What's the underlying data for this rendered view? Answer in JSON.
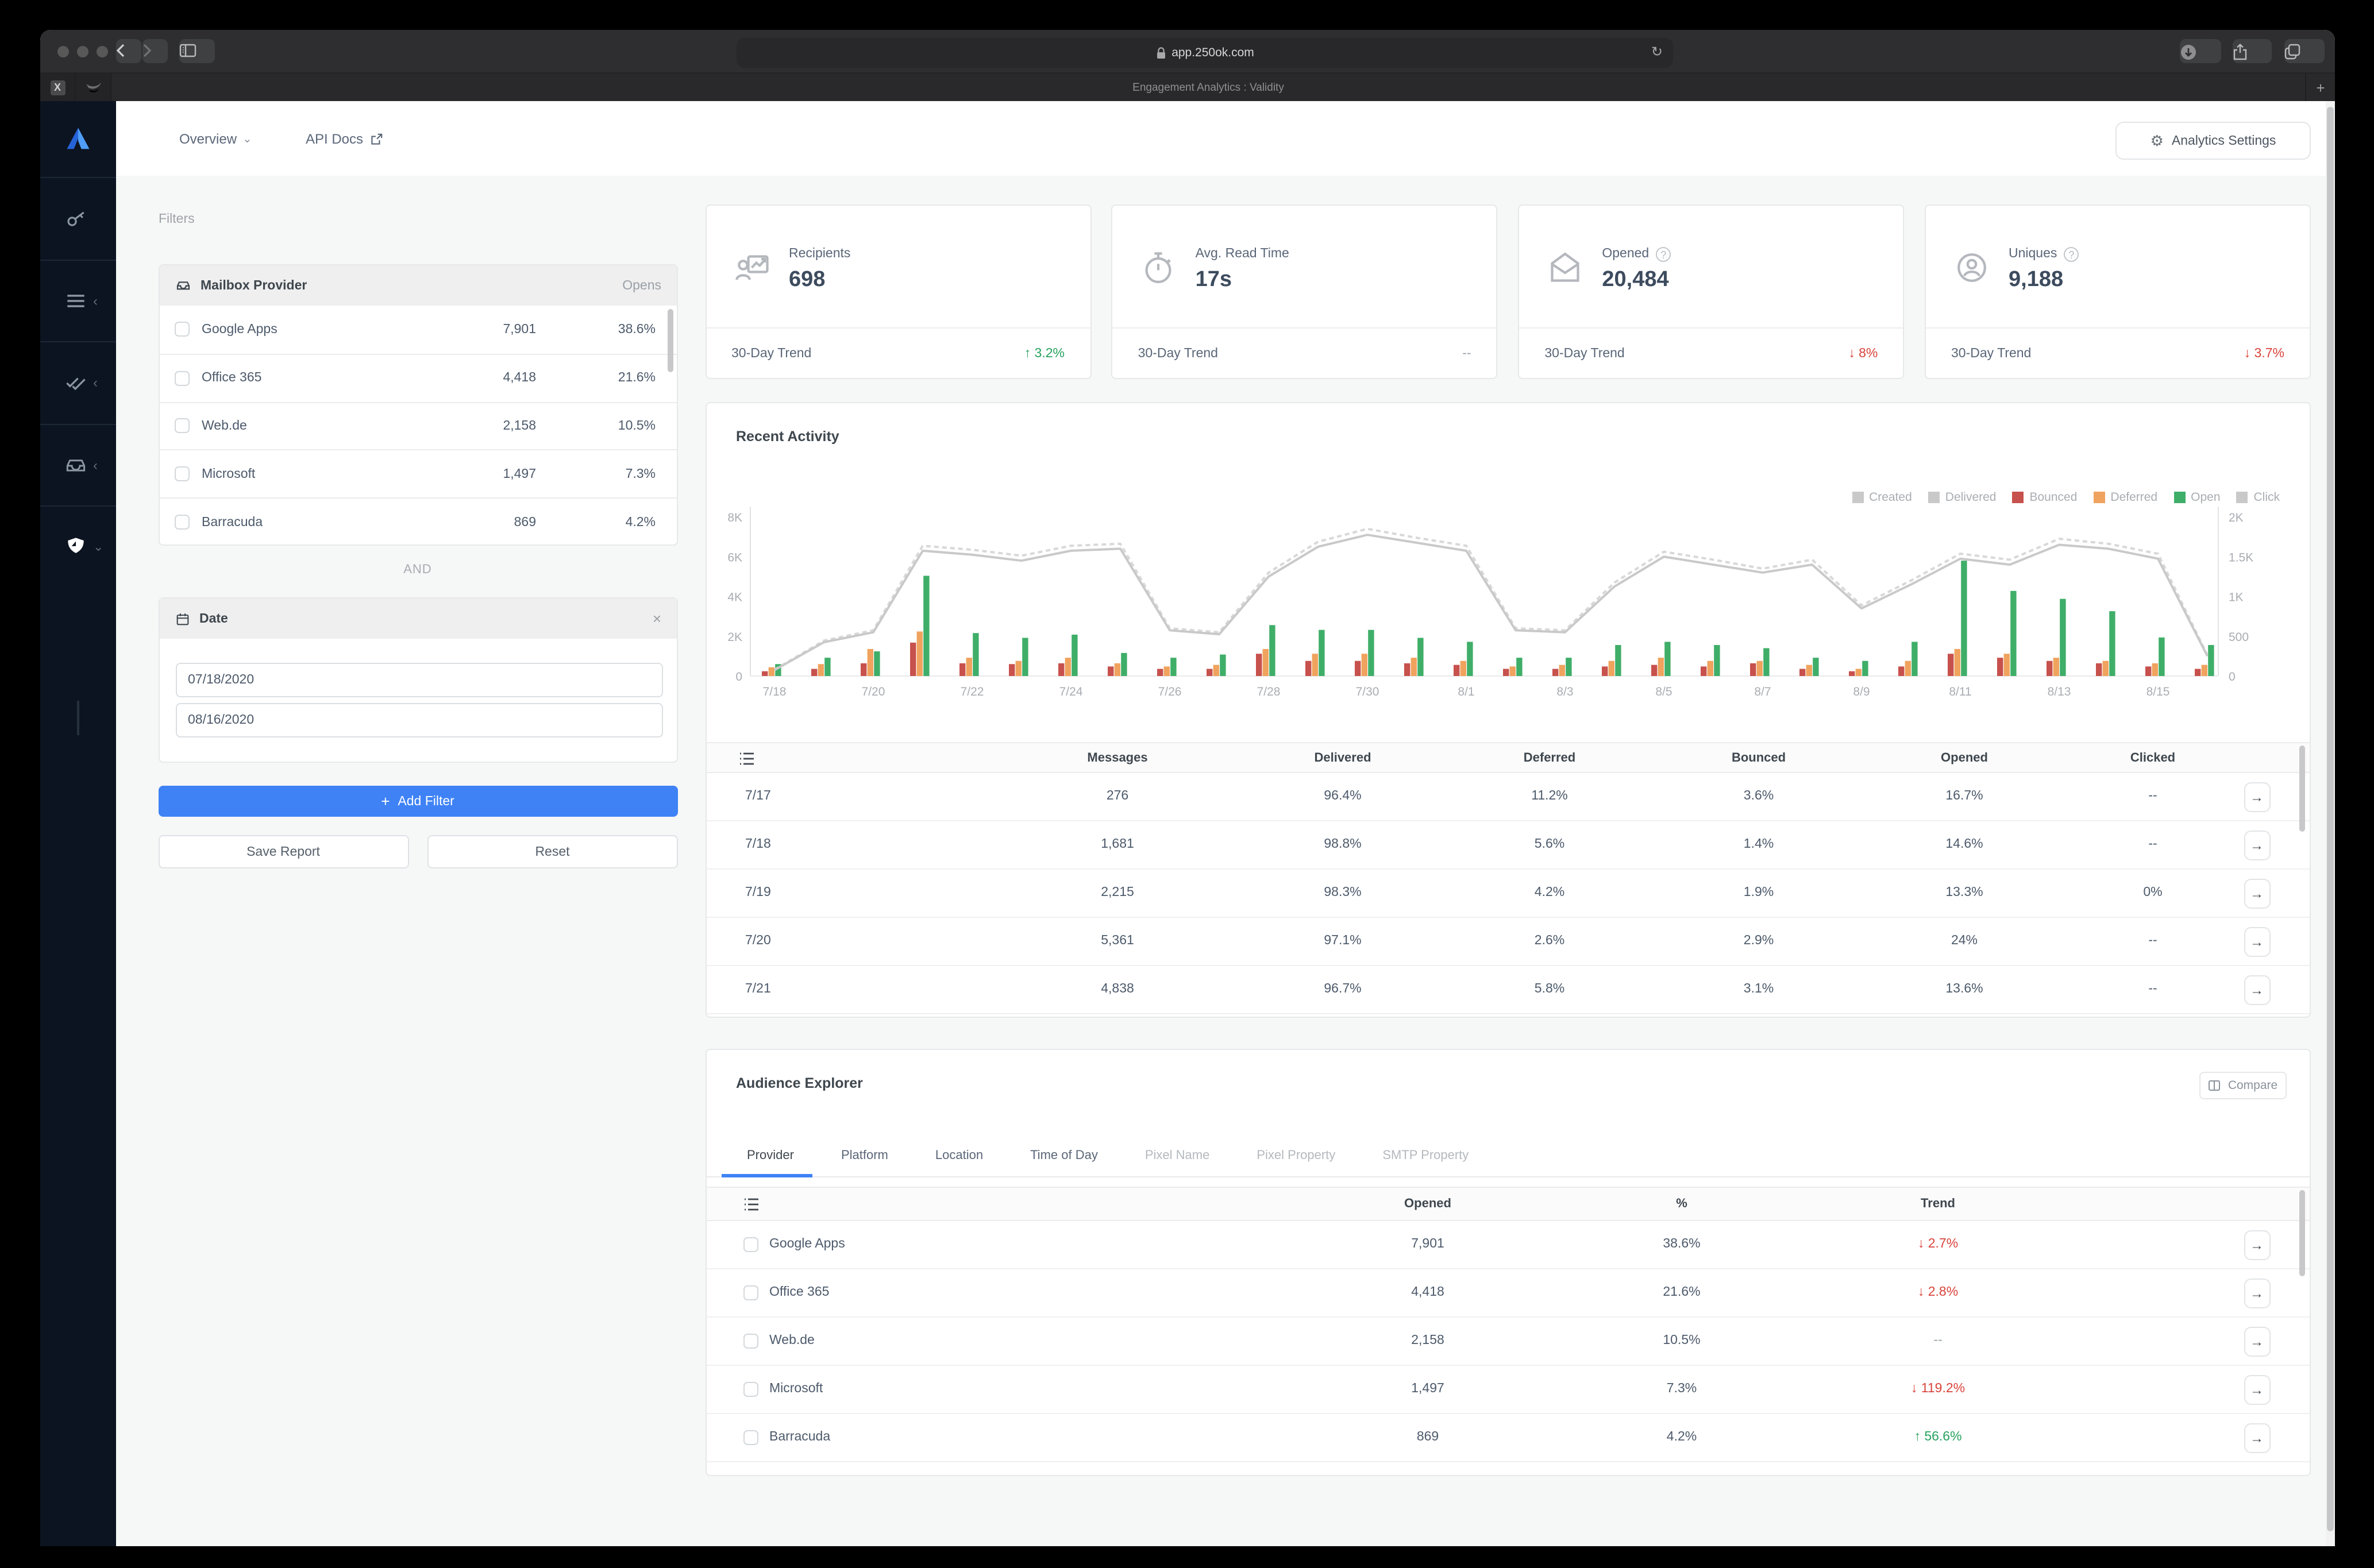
{
  "browser": {
    "url": "app.250ok.com",
    "tab_title": "Engagement Analytics : Validity",
    "pinned_tab_excel": "X",
    "reload_glyph": "↻",
    "new_tab_glyph": "+",
    "back_disabled": false
  },
  "nav": {
    "overview": "Overview",
    "api_docs": "API Docs",
    "settings": "Analytics Settings"
  },
  "filters": {
    "heading": "Filters",
    "provider_card": {
      "title": "Mailbox Provider",
      "metric": "Opens",
      "rows": [
        {
          "name": "Google Apps",
          "opens": "7,901",
          "pct": "38.6%"
        },
        {
          "name": "Office 365",
          "opens": "4,418",
          "pct": "21.6%"
        },
        {
          "name": "Web.de",
          "opens": "2,158",
          "pct": "10.5%"
        },
        {
          "name": "Microsoft",
          "opens": "1,497",
          "pct": "7.3%"
        },
        {
          "name": "Barracuda",
          "opens": "869",
          "pct": "4.2%"
        }
      ]
    },
    "conjunction": "AND",
    "date_card": {
      "title": "Date",
      "close": "×",
      "start": "07/18/2020",
      "end": "08/16/2020"
    },
    "add_filter": "Add Filter",
    "save_report": "Save Report",
    "reset": "Reset"
  },
  "stats": [
    {
      "label": "Recipients",
      "value": "698",
      "trend_label": "30-Day Trend",
      "trend": "↑ 3.2%",
      "trend_color": "#27a35f"
    },
    {
      "label": "Avg. Read Time",
      "value": "17s",
      "trend_label": "30-Day Trend",
      "trend": "--",
      "trend_color": "#9aa0a6"
    },
    {
      "label": "Opened",
      "help": "?",
      "value": "20,484",
      "trend_label": "30-Day Trend",
      "trend": "↓ 8%",
      "trend_color": "#d9443c"
    },
    {
      "label": "Uniques",
      "help": "?",
      "value": "9,188",
      "trend_label": "30-Day Trend",
      "trend": "↓ 3.7%",
      "trend_color": "#d9443c"
    }
  ],
  "recent": {
    "title": "Recent Activity",
    "legend": [
      {
        "label": "Created",
        "color": "#c9c9c9"
      },
      {
        "label": "Delivered",
        "color": "#c9c9c9"
      },
      {
        "label": "Bounced",
        "color": "#c7514d"
      },
      {
        "label": "Deferred",
        "color": "#f0a35e"
      },
      {
        "label": "Open",
        "color": "#3fae68"
      },
      {
        "label": "Click",
        "color": "#c9c9c9"
      }
    ],
    "headers": [
      "Messages",
      "Delivered",
      "Deferred",
      "Bounced",
      "Opened",
      "Clicked"
    ],
    "rows": [
      {
        "date": "7/17",
        "messages": "276",
        "delivered": "96.4%",
        "deferred": "11.2%",
        "bounced": "3.6%",
        "opened": "16.7%",
        "clicked": "--"
      },
      {
        "date": "7/18",
        "messages": "1,681",
        "delivered": "98.8%",
        "deferred": "5.6%",
        "bounced": "1.4%",
        "opened": "14.6%",
        "clicked": "--"
      },
      {
        "date": "7/19",
        "messages": "2,215",
        "delivered": "98.3%",
        "deferred": "4.2%",
        "bounced": "1.9%",
        "opened": "13.3%",
        "clicked": "0%"
      },
      {
        "date": "7/20",
        "messages": "5,361",
        "delivered": "97.1%",
        "deferred": "2.6%",
        "bounced": "2.9%",
        "opened": "24%",
        "clicked": "--"
      },
      {
        "date": "7/21",
        "messages": "4,838",
        "delivered": "96.7%",
        "deferred": "5.8%",
        "bounced": "3.1%",
        "opened": "13.6%",
        "clicked": "--"
      }
    ],
    "row_arrow": "→"
  },
  "chart_data": {
    "type": "bar",
    "title": "Recent Activity",
    "x": [
      "7/18",
      "7/19",
      "7/20",
      "7/21",
      "7/22",
      "7/23",
      "7/24",
      "7/25",
      "7/26",
      "7/27",
      "7/28",
      "7/29",
      "7/30",
      "7/31",
      "8/1",
      "8/2",
      "8/3",
      "8/4",
      "8/5",
      "8/6",
      "8/7",
      "8/8",
      "8/9",
      "8/10",
      "8/11",
      "8/12",
      "8/13",
      "8/14",
      "8/15",
      "8/16"
    ],
    "x_tick_labels": [
      "7/18",
      "7/20",
      "7/22",
      "7/24",
      "7/26",
      "7/28",
      "7/30",
      "8/1",
      "8/3",
      "8/5",
      "8/7",
      "8/9",
      "8/11",
      "8/13",
      "8/15"
    ],
    "left_axis": {
      "max": 8000,
      "tick_values": [
        8000,
        6000,
        4000,
        2000,
        0
      ],
      "tick_labels": [
        "8K",
        "6K",
        "4K",
        "2K",
        "0"
      ]
    },
    "right_axis": {
      "max": 2000,
      "tick_values": [
        2000,
        1500,
        1000,
        500,
        0
      ],
      "tick_labels": [
        "2K",
        "1.5K",
        "1K",
        "500",
        "0"
      ]
    },
    "legend_position": "top-right",
    "grid": false,
    "series": [
      {
        "name": "Created",
        "type": "line",
        "style": "dashed",
        "axis": "left",
        "color": "#d8d8d8",
        "values": [
          320,
          1780,
          2300,
          6550,
          6350,
          6050,
          6550,
          6650,
          2400,
          2200,
          5200,
          6750,
          7400,
          6950,
          6550,
          2400,
          2300,
          4700,
          6250,
          5850,
          5400,
          5850,
          3550,
          4800,
          6150,
          5850,
          6900,
          6650,
          6150,
          1050
        ]
      },
      {
        "name": "Delivered",
        "type": "line",
        "style": "solid",
        "axis": "left",
        "color": "#c9c9c9",
        "values": [
          300,
          1700,
          2200,
          6300,
          6100,
          5800,
          6300,
          6400,
          2300,
          2100,
          5000,
          6500,
          7100,
          6700,
          6300,
          2300,
          2200,
          4500,
          6000,
          5600,
          5200,
          5600,
          3400,
          4600,
          5900,
          5600,
          6600,
          6400,
          5900,
          1000
        ]
      },
      {
        "name": "Bounced",
        "type": "bar",
        "axis": "right",
        "color": "#c7514d",
        "values": [
          60,
          90,
          160,
          420,
          160,
          150,
          160,
          120,
          90,
          90,
          280,
          190,
          190,
          160,
          140,
          90,
          90,
          120,
          140,
          120,
          160,
          90,
          60,
          120,
          280,
          230,
          190,
          160,
          120,
          90
        ]
      },
      {
        "name": "Deferred",
        "type": "bar",
        "axis": "right",
        "color": "#f0a35e",
        "values": [
          110,
          150,
          340,
          560,
          230,
          190,
          230,
          160,
          120,
          140,
          340,
          280,
          280,
          230,
          190,
          120,
          140,
          190,
          230,
          190,
          190,
          140,
          90,
          190,
          340,
          280,
          230,
          190,
          160,
          140
        ]
      },
      {
        "name": "Open",
        "type": "bar",
        "axis": "right",
        "color": "#3fae68",
        "values": [
          150,
          230,
          310,
          1260,
          540,
          480,
          520,
          290,
          230,
          270,
          640,
          580,
          580,
          480,
          430,
          230,
          230,
          390,
          430,
          390,
          350,
          230,
          190,
          430,
          1450,
          1070,
          970,
          815,
          485,
          390
        ]
      },
      {
        "name": "Click",
        "type": "bar",
        "axis": "right",
        "color": "#c9c9c9",
        "values": [
          0,
          0,
          0,
          0,
          0,
          0,
          0,
          0,
          0,
          0,
          0,
          0,
          0,
          0,
          0,
          0,
          0,
          0,
          0,
          0,
          0,
          0,
          0,
          0,
          0,
          0,
          0,
          0,
          0,
          0
        ]
      }
    ]
  },
  "audience": {
    "title": "Audience Explorer",
    "compare": "Compare",
    "tabs": [
      "Provider",
      "Platform",
      "Location",
      "Time of Day",
      "Pixel Name",
      "Pixel Property",
      "SMTP Property"
    ],
    "headers": [
      "Opened",
      "%",
      "Trend"
    ],
    "rows": [
      {
        "name": "Google Apps",
        "opened": "7,901",
        "pct": "38.6%",
        "trend": "↓ 2.7%",
        "trend_color": "#d9443c"
      },
      {
        "name": "Office 365",
        "opened": "4,418",
        "pct": "21.6%",
        "trend": "↓ 2.8%",
        "trend_color": "#d9443c"
      },
      {
        "name": "Web.de",
        "opened": "2,158",
        "pct": "10.5%",
        "trend": "--",
        "trend_color": "#9aa0a6"
      },
      {
        "name": "Microsoft",
        "opened": "1,497",
        "pct": "7.3%",
        "trend": "↓ 119.2%",
        "trend_color": "#d9443c"
      },
      {
        "name": "Barracuda",
        "opened": "869",
        "pct": "4.2%",
        "trend": "↑ 56.6%",
        "trend_color": "#27a35f"
      }
    ],
    "row_arrow": "→"
  }
}
